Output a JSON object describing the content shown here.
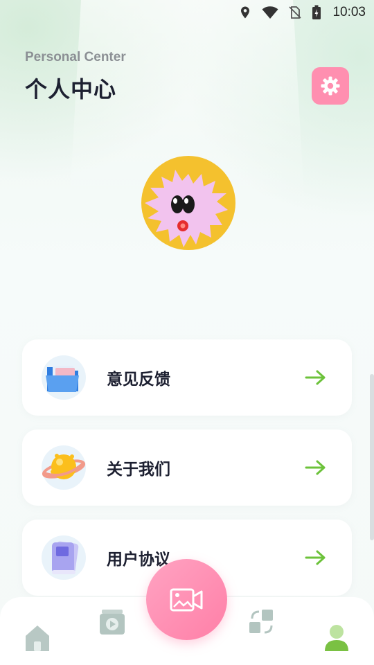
{
  "status_bar": {
    "time": "10:03",
    "icons": [
      "location-icon",
      "wifi-icon",
      "no-sim-icon",
      "battery-charging-icon"
    ]
  },
  "header": {
    "subtitle": "Personal Center",
    "title": "个人中心",
    "settings_icon": "gear-icon",
    "accent": "#ff8fb0"
  },
  "avatar": {
    "icon": "cartoon-star-face-avatar"
  },
  "menu": {
    "items": [
      {
        "label": "意见反馈",
        "icon": "folder-icon"
      },
      {
        "label": "关于我们",
        "icon": "planet-icon"
      },
      {
        "label": "用户协议",
        "icon": "book-icon"
      }
    ],
    "arrow_color": "#6cc23a"
  },
  "tabbar": {
    "tabs": [
      {
        "name": "home",
        "icon": "home-icon",
        "active": false
      },
      {
        "name": "video",
        "icon": "video-play-icon",
        "active": false
      },
      {
        "name": "convert",
        "icon": "convert-icon",
        "active": false
      },
      {
        "name": "profile",
        "icon": "user-icon",
        "active": true
      }
    ],
    "fab_icon": "video-camera-icon",
    "active_color": "#7ac143"
  }
}
